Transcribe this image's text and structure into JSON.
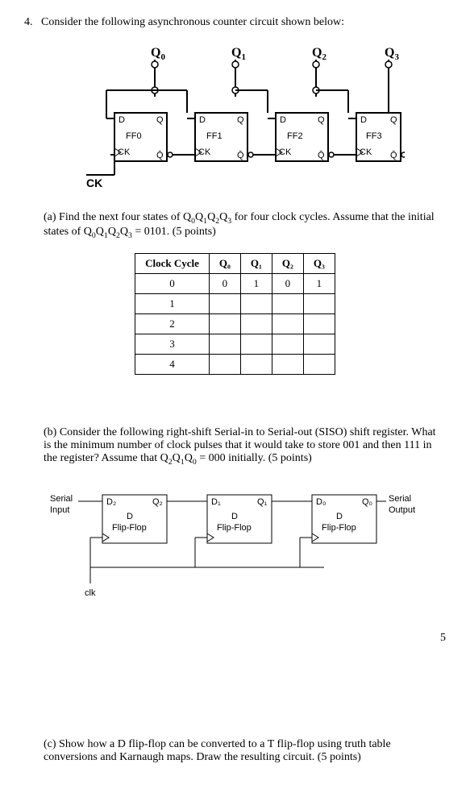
{
  "problem": {
    "number": "4.",
    "intro": "Consider the following asynchronous counter circuit shown below:"
  },
  "counter_diagram": {
    "q_labels": [
      "Q",
      "Q",
      "Q",
      "Q"
    ],
    "q_subs": [
      "0",
      "1",
      "2",
      "3"
    ],
    "ff_names": [
      "FF0",
      "FF1",
      "FF2",
      "FF3"
    ],
    "d_label": "D",
    "q_out": "Q",
    "qbar_out": "Q",
    "ck_label": "CK",
    "ck_main": "CK"
  },
  "part_a": {
    "label": "(a)",
    "text_before": "Find the next four states of Q",
    "sub0": "0",
    "q1": "Q",
    "sub1": "1",
    "q2": "Q",
    "sub2": "2",
    "q3": "Q",
    "sub3": "3",
    "text_mid": " for four clock cycles. Assume that the initial states of Q",
    "sub0b": "0",
    "q1b": "Q",
    "sub1b": "1",
    "q2b": "Q",
    "sub2b": "2",
    "q3b": "Q",
    "sub3b": "3",
    "text_after": " = 0101. (5 points)"
  },
  "state_table": {
    "headers": [
      "Clock Cycle",
      "Q₀",
      "Q₁",
      "Q₂",
      "Q₃"
    ],
    "rows": [
      [
        "0",
        "0",
        "1",
        "0",
        "1"
      ],
      [
        "1",
        "",
        "",
        "",
        ""
      ],
      [
        "2",
        "",
        "",
        "",
        ""
      ],
      [
        "3",
        "",
        "",
        "",
        ""
      ],
      [
        "4",
        "",
        "",
        "",
        ""
      ]
    ]
  },
  "part_b": {
    "label": "(b)",
    "text_before": "Consider the following right-shift Serial-in to Serial-out (SISO) shift register. What is the minimum number of clock pulses that it would take to store 001 and then 111 in the register? Assume that Q",
    "sub2": "2",
    "q1": "Q",
    "sub1": "1",
    "q0": "Q",
    "sub0": "0",
    "text_after": " = 000 initially. (5 points)"
  },
  "siso_diagram": {
    "serial_input": "Serial",
    "input2": "Input",
    "serial_output": "Serial",
    "output2": "Output",
    "d_labels": [
      "D₂",
      "D₁",
      "D₀"
    ],
    "q_labels": [
      "Q₂",
      "Q₁",
      "Q₀"
    ],
    "d_text": "D",
    "ff_text": "Flip-Flop",
    "clk": "clk"
  },
  "page_number": "5",
  "part_c": {
    "label": "(c)",
    "text": "Show how a D flip-flop can be converted to a T flip-flop using truth table conversions and Karnaugh maps. Draw the resulting circuit. (5 points)"
  }
}
